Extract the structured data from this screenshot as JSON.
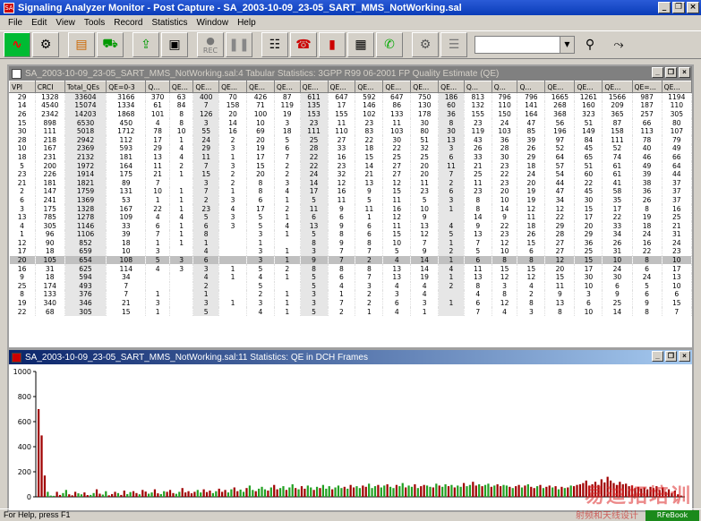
{
  "app": {
    "title": "Signaling Analyzer Monitor - Post Capture - SA_2003-10-09_23-05_SART_MMS_NotWorking.sal",
    "win_buttons": [
      "_",
      "❐",
      "×"
    ]
  },
  "menu": [
    "File",
    "Edit",
    "View",
    "Tools",
    "Record",
    "Statistics",
    "Window",
    "Help"
  ],
  "toolbar": {
    "rec_label": "REC",
    "buttons": [
      "monitor-icon",
      "gear-icon",
      "filter-icon",
      "capture-icon",
      "export-icon",
      "save-icon",
      "record-icon",
      "pause-icon",
      "graph-icon",
      "phone-icon",
      "bar-chart-icon",
      "table-icon",
      "call-icon",
      "decode-icon",
      "list-icon",
      "search-icon",
      "route-icon"
    ],
    "combo_value": ""
  },
  "table_window": {
    "title": "SA_2003-10-09_23-05_SART_MMS_NotWorking.sal:4 Tabular Statistics: 3GPP R99 06-2001 FP Quality Estimate (QE)",
    "columns": [
      "VPI",
      "CRCI",
      "Total_QEs",
      "QE=0-3",
      "Q...",
      "QE...",
      "QE...",
      "QE...",
      "QE...",
      "QE...",
      "QE...",
      "QE...",
      "QE...",
      "QE...",
      "QE...",
      "QE...",
      "Q...",
      "Q...",
      "Q...",
      "QE...",
      "QE...",
      "QE...",
      "QE=...",
      "QE...",
      "QE..."
    ],
    "rows": [
      [
        "29",
        "1328",
        "33604",
        "3166",
        "370",
        "63",
        "400",
        "70",
        "426",
        "87",
        "611",
        "647",
        "592",
        "647",
        "750",
        "186",
        "813",
        "796",
        "796",
        "1665",
        "1261",
        "1566",
        "987",
        "1194"
      ],
      [
        "14",
        "4540",
        "15074",
        "1334",
        "61",
        "84",
        "7",
        "158",
        "71",
        "119",
        "135",
        "17",
        "146",
        "86",
        "130",
        "60",
        "132",
        "110",
        "141",
        "268",
        "160",
        "209",
        "187",
        "110"
      ],
      [
        "26",
        "2342",
        "14203",
        "1868",
        "101",
        "8",
        "126",
        "20",
        "100",
        "19",
        "153",
        "155",
        "102",
        "133",
        "178",
        "36",
        "155",
        "150",
        "164",
        "368",
        "323",
        "365",
        "257",
        "305"
      ],
      [
        "15",
        "898",
        "6530",
        "450",
        "4",
        "8",
        "3",
        "14",
        "10",
        "3",
        "23",
        "11",
        "23",
        "11",
        "30",
        "8",
        "23",
        "24",
        "47",
        "56",
        "51",
        "87",
        "66",
        "80"
      ],
      [
        "30",
        "111",
        "5018",
        "1712",
        "78",
        "10",
        "55",
        "16",
        "69",
        "18",
        "111",
        "110",
        "83",
        "103",
        "80",
        "30",
        "119",
        "103",
        "85",
        "196",
        "149",
        "158",
        "113",
        "107"
      ],
      [
        "28",
        "218",
        "2942",
        "112",
        "17",
        "1",
        "24",
        "2",
        "20",
        "5",
        "25",
        "27",
        "22",
        "30",
        "51",
        "13",
        "43",
        "36",
        "39",
        "97",
        "84",
        "111",
        "78",
        "79"
      ],
      [
        "10",
        "167",
        "2369",
        "593",
        "29",
        "4",
        "29",
        "3",
        "19",
        "6",
        "28",
        "33",
        "18",
        "22",
        "32",
        "3",
        "26",
        "28",
        "26",
        "52",
        "45",
        "52",
        "40",
        "49"
      ],
      [
        "18",
        "231",
        "2132",
        "181",
        "13",
        "4",
        "11",
        "1",
        "17",
        "7",
        "22",
        "16",
        "15",
        "25",
        "25",
        "6",
        "33",
        "30",
        "29",
        "64",
        "65",
        "74",
        "46",
        "66"
      ],
      [
        "5",
        "200",
        "1972",
        "164",
        "11",
        "2",
        "7",
        "3",
        "15",
        "2",
        "22",
        "23",
        "14",
        "27",
        "20",
        "11",
        "21",
        "23",
        "18",
        "57",
        "51",
        "61",
        "49",
        "64"
      ],
      [
        "23",
        "226",
        "1914",
        "175",
        "21",
        "1",
        "15",
        "2",
        "20",
        "2",
        "24",
        "32",
        "21",
        "27",
        "20",
        "7",
        "25",
        "22",
        "24",
        "54",
        "60",
        "61",
        "39",
        "44"
      ],
      [
        "21",
        "181",
        "1821",
        "89",
        "7",
        "",
        "3",
        "2",
        "8",
        "3",
        "14",
        "12",
        "13",
        "12",
        "11",
        "2",
        "11",
        "23",
        "20",
        "44",
        "22",
        "41",
        "38",
        "37"
      ],
      [
        "2",
        "147",
        "1759",
        "131",
        "10",
        "1",
        "7",
        "1",
        "8",
        "4",
        "17",
        "16",
        "9",
        "15",
        "23",
        "6",
        "23",
        "20",
        "19",
        "47",
        "45",
        "58",
        "36",
        "37"
      ],
      [
        "6",
        "241",
        "1369",
        "53",
        "1",
        "1",
        "2",
        "3",
        "6",
        "1",
        "5",
        "11",
        "5",
        "11",
        "5",
        "3",
        "8",
        "10",
        "19",
        "34",
        "30",
        "35",
        "26",
        "37"
      ],
      [
        "3",
        "175",
        "1328",
        "167",
        "22",
        "1",
        "23",
        "4",
        "17",
        "2",
        "11",
        "9",
        "11",
        "16",
        "10",
        "1",
        "8",
        "14",
        "12",
        "12",
        "15",
        "17",
        "8",
        "16"
      ],
      [
        "13",
        "785",
        "1278",
        "109",
        "4",
        "4",
        "5",
        "3",
        "5",
        "1",
        "6",
        "6",
        "1",
        "12",
        "9",
        "",
        "14",
        "9",
        "11",
        "22",
        "17",
        "22",
        "19",
        "25"
      ],
      [
        "4",
        "305",
        "1146",
        "33",
        "6",
        "1",
        "6",
        "3",
        "5",
        "4",
        "13",
        "9",
        "6",
        "11",
        "13",
        "4",
        "9",
        "22",
        "18",
        "29",
        "20",
        "33",
        "18",
        "21"
      ],
      [
        "1",
        "96",
        "1106",
        "39",
        "7",
        "1",
        "8",
        "",
        "3",
        "1",
        "5",
        "8",
        "6",
        "15",
        "12",
        "5",
        "13",
        "23",
        "26",
        "28",
        "29",
        "34",
        "24",
        "31"
      ],
      [
        "12",
        "90",
        "852",
        "18",
        "1",
        "1",
        "1",
        "",
        "1",
        "",
        "8",
        "9",
        "8",
        "10",
        "7",
        "1",
        "7",
        "12",
        "15",
        "27",
        "36",
        "26",
        "16",
        "24"
      ],
      [
        "17",
        "18",
        "659",
        "10",
        "3",
        "",
        "4",
        "",
        "3",
        "1",
        "3",
        "7",
        "7",
        "5",
        "9",
        "2",
        "5",
        "10",
        "6",
        "27",
        "25",
        "31",
        "22",
        "23"
      ],
      [
        "20",
        "105",
        "654",
        "108",
        "5",
        "3",
        "6",
        "",
        "3",
        "1",
        "9",
        "7",
        "2",
        "4",
        "14",
        "1",
        "6",
        "8",
        "8",
        "12",
        "15",
        "10",
        "8",
        "10"
      ],
      [
        "16",
        "31",
        "625",
        "114",
        "4",
        "3",
        "3",
        "1",
        "5",
        "2",
        "8",
        "8",
        "8",
        "13",
        "14",
        "4",
        "11",
        "15",
        "15",
        "20",
        "17",
        "24",
        "6",
        "17"
      ],
      [
        "9",
        "18",
        "594",
        "34",
        "",
        "",
        "4",
        "1",
        "4",
        "1",
        "5",
        "6",
        "7",
        "13",
        "19",
        "1",
        "13",
        "12",
        "12",
        "15",
        "30",
        "30",
        "24",
        "13"
      ],
      [
        "25",
        "174",
        "493",
        "7",
        "",
        "",
        "2",
        "",
        "5",
        "",
        "5",
        "4",
        "3",
        "4",
        "4",
        "2",
        "8",
        "3",
        "4",
        "11",
        "10",
        "6",
        "5",
        "10"
      ],
      [
        "8",
        "133",
        "376",
        "7",
        "1",
        "",
        "1",
        "",
        "2",
        "1",
        "3",
        "1",
        "2",
        "3",
        "4",
        "",
        "4",
        "8",
        "2",
        "9",
        "3",
        "9",
        "6",
        "6"
      ],
      [
        "19",
        "340",
        "346",
        "21",
        "3",
        "",
        "3",
        "1",
        "3",
        "1",
        "3",
        "7",
        "2",
        "6",
        "3",
        "1",
        "6",
        "12",
        "8",
        "13",
        "6",
        "25",
        "9",
        "15"
      ],
      [
        "22",
        "68",
        "305",
        "15",
        "1",
        "",
        "5",
        "",
        "4",
        "1",
        "5",
        "2",
        "1",
        "4",
        "1",
        "",
        "7",
        "4",
        "3",
        "8",
        "10",
        "14",
        "8",
        "7"
      ]
    ],
    "selected_row_index": 19
  },
  "hist_window": {
    "title": "SA_2003-10-09_23-05_SART_MMS_NotWorking.sal:11 Statistics: QE in DCH Frames"
  },
  "chart_data": {
    "type": "bar",
    "title": "",
    "xlabel": "",
    "ylabel": "",
    "ylim": [
      0,
      1000
    ],
    "yticks": [
      0,
      200,
      400,
      600,
      800,
      1000
    ],
    "grid": false,
    "colors": {
      "series_a": "#a00000",
      "series_b": "#22a022"
    },
    "values": [
      700,
      490,
      170,
      40,
      10,
      8,
      40,
      15,
      30,
      55,
      20,
      12,
      40,
      28,
      20,
      35,
      14,
      15,
      30,
      60,
      25,
      18,
      45,
      12,
      22,
      40,
      30,
      15,
      50,
      22,
      38,
      45,
      30,
      20,
      55,
      42,
      25,
      35,
      60,
      28,
      22,
      45,
      40,
      55,
      30,
      24,
      40,
      70,
      35,
      45,
      28,
      40,
      55,
      35,
      60,
      38,
      50,
      30,
      45,
      65,
      40,
      55,
      35,
      60,
      75,
      45,
      58,
      40,
      70,
      90,
      55,
      45,
      65,
      80,
      60,
      50,
      75,
      95,
      60,
      70,
      85,
      55,
      75,
      100,
      70,
      60,
      85,
      65,
      90,
      75,
      55,
      80,
      70,
      95,
      65,
      85,
      60,
      75,
      90,
      70,
      80,
      65,
      95,
      75,
      85,
      70,
      90,
      80,
      105,
      70,
      85,
      95,
      75,
      90,
      100,
      80,
      70,
      95,
      85,
      110,
      75,
      90,
      80,
      100,
      70,
      85,
      95,
      90,
      80,
      75,
      105,
      90,
      80,
      100,
      85,
      95,
      75,
      90,
      80,
      110,
      85,
      95,
      120,
      90,
      100,
      85,
      95,
      105,
      80,
      90,
      100,
      85,
      95,
      90,
      80,
      70,
      85,
      95,
      75,
      90,
      100,
      80,
      70,
      85,
      95,
      70,
      80,
      90,
      75,
      85,
      60,
      80,
      70,
      75,
      90,
      85,
      95,
      100,
      110,
      130,
      90,
      100,
      120,
      95,
      140,
      115,
      160,
      130,
      110,
      95,
      120,
      100,
      105,
      85,
      90,
      70,
      80,
      65,
      75,
      60,
      80,
      70,
      85,
      55,
      75,
      40,
      60,
      30,
      50,
      20,
      10
    ],
    "green_indices": [
      3,
      4,
      5,
      8,
      9,
      13,
      14,
      17,
      18,
      21,
      22,
      26,
      29,
      30,
      33,
      36,
      37,
      40,
      41,
      45,
      46,
      52,
      53,
      57,
      58,
      62,
      63,
      66,
      67,
      69,
      70,
      72,
      73,
      74,
      76,
      79,
      80,
      82,
      83,
      85,
      88,
      89,
      91,
      93,
      94,
      95,
      97,
      98,
      99,
      101,
      104,
      105,
      108,
      109,
      110,
      112,
      113,
      115,
      116,
      118,
      119,
      121,
      122,
      124,
      127,
      128,
      130,
      132,
      133,
      135,
      137,
      138,
      140,
      141,
      144,
      146,
      147,
      149,
      152,
      153,
      155,
      158,
      160,
      163,
      165,
      168,
      170,
      172,
      174
    ]
  },
  "status": {
    "text": "For Help, press F1",
    "watermark": "易迪拓培训",
    "watermark_sub": "射频和天线设计",
    "brand": "RFeBook"
  }
}
